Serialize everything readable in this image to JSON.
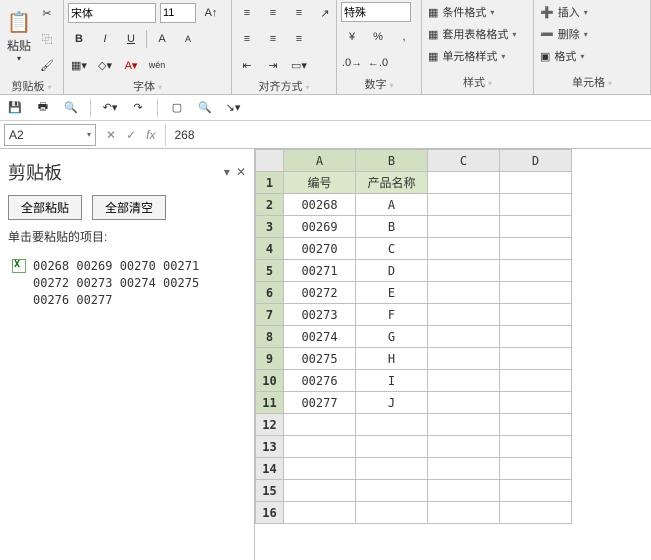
{
  "ribbon": {
    "groups": {
      "clipboard": {
        "label": "剪贴板",
        "paste": "粘贴"
      },
      "font": {
        "label": "字体",
        "name": "宋体",
        "size": "11",
        "bold": "B",
        "italic": "I",
        "underline": "U"
      },
      "align": {
        "label": "对齐方式",
        "special": "特殊"
      },
      "number": {
        "label": "数字",
        "currency": "¥",
        "percent": "%"
      },
      "styles": {
        "label": "样式",
        "cond": "条件格式",
        "table": "套用表格格式",
        "cell": "单元格样式"
      },
      "cells": {
        "label": "单元格",
        "insert": "插入",
        "delete": "删除",
        "format": "格式"
      }
    }
  },
  "formula_bar": {
    "cell_ref": "A2",
    "value": "268",
    "fx": "fx"
  },
  "clipboard_pane": {
    "title": "剪贴板",
    "paste_all": "全部粘贴",
    "clear_all": "全部清空",
    "hint": "单击要粘贴的项目:",
    "items": [
      {
        "text": "00268 00269 00270 00271 00272 00273 00274 00275 00276 00277"
      }
    ]
  },
  "sheet": {
    "columns": [
      "A",
      "B",
      "C",
      "D"
    ],
    "row_headers": [
      "1",
      "2",
      "3",
      "4",
      "5",
      "6",
      "7",
      "8",
      "9",
      "10",
      "11",
      "12",
      "13",
      "14",
      "15",
      "16"
    ],
    "header_row": {
      "A": "编号",
      "B": "产品名称"
    },
    "rows": [
      {
        "A": "00268",
        "B": "A"
      },
      {
        "A": "00269",
        "B": "B"
      },
      {
        "A": "00270",
        "B": "C"
      },
      {
        "A": "00271",
        "B": "D"
      },
      {
        "A": "00272",
        "B": "E"
      },
      {
        "A": "00273",
        "B": "F"
      },
      {
        "A": "00274",
        "B": "G"
      },
      {
        "A": "00275",
        "B": "H"
      },
      {
        "A": "00276",
        "B": "I"
      },
      {
        "A": "00277",
        "B": "J"
      }
    ]
  }
}
